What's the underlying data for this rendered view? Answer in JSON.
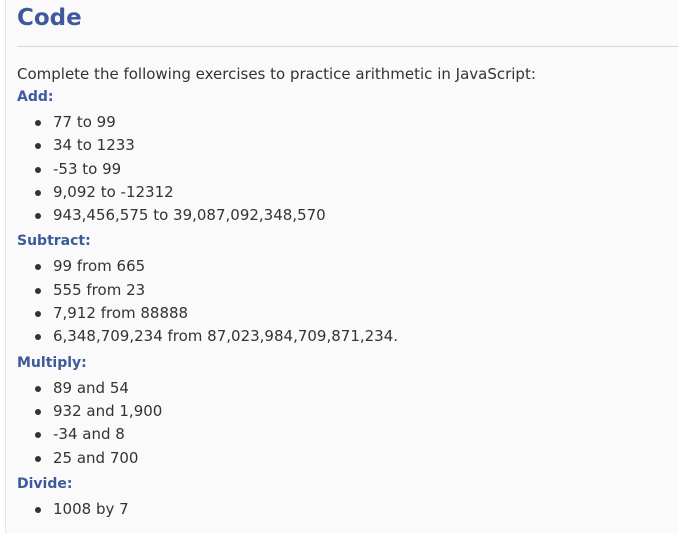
{
  "title": "Code",
  "intro": "Complete the following exercises to practice arithmetic in JavaScript:",
  "sections": [
    {
      "heading": "Add:",
      "items": [
        "77 to 99",
        "34 to 1233",
        "-53 to 99",
        "9,092 to -12312",
        "943,456,575 to 39,087,092,348,570"
      ]
    },
    {
      "heading": "Subtract:",
      "items": [
        "99 from 665",
        "555 from 23",
        "7,912 from 88888",
        "6,348,709,234 from 87,023,984,709,871,234."
      ]
    },
    {
      "heading": "Multiply:",
      "items": [
        "89 and 54",
        "932 and 1,900",
        "-34 and 8",
        "25 and 700"
      ]
    },
    {
      "heading": "Divide:",
      "items": [
        "1008 by 7"
      ]
    }
  ]
}
